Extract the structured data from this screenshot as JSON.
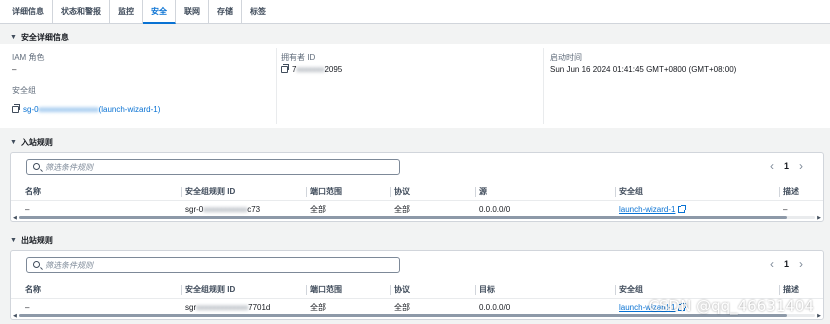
{
  "tabs": [
    {
      "label": "详细信息",
      "active": false
    },
    {
      "label": "状态和警报",
      "active": false
    },
    {
      "label": "监控",
      "active": false
    },
    {
      "label": "安全",
      "active": true
    },
    {
      "label": "联网",
      "active": false
    },
    {
      "label": "存储",
      "active": false
    },
    {
      "label": "标签",
      "active": false
    }
  ],
  "security_details": {
    "title": "安全详细信息",
    "iam_role_label": "IAM 角色",
    "iam_role_value": "–",
    "owner_id_label": "拥有者 ID",
    "owner_id_prefix": "7",
    "owner_id_suffix": "2095",
    "launch_time_label": "启动时间",
    "launch_time_value": "Sun Jun 16 2024 01:41:45 GMT+0800 (GMT+08:00)",
    "security_group_label": "安全组",
    "security_group_prefix": "sg-0",
    "security_group_suffix": "(launch-wizard-1)"
  },
  "inbound": {
    "title": "入站规则",
    "search_placeholder": "筛选条件规则",
    "page": "1",
    "columns": [
      "名称",
      "安全组规则 ID",
      "端口范围",
      "协议",
      "源",
      "安全组",
      "描述"
    ],
    "row": {
      "name": "–",
      "rule_id_prefix": "sgr-0",
      "rule_id_suffix": "c73",
      "port_range": "全部",
      "protocol": "全部",
      "source": "0.0.0.0/0",
      "security_group": "launch-wizard-1",
      "description": "–"
    }
  },
  "outbound": {
    "title": "出站规则",
    "search_placeholder": "筛选条件规则",
    "page": "1",
    "columns": [
      "名称",
      "安全组规则 ID",
      "端口范围",
      "协议",
      "目标",
      "安全组",
      "描述"
    ],
    "row": {
      "name": "–",
      "rule_id_prefix": "sgr",
      "rule_id_suffix": "7701d",
      "port_range": "全部",
      "protocol": "全部",
      "destination": "0.0.0.0/0",
      "security_group": "launch-wizard-1"
    }
  },
  "watermark": "CSDN @qq_46631404",
  "colors": {
    "link": "#0972d3",
    "text": "#16191f",
    "label": "#5f6b7a",
    "page_bg": "#f2f3f3",
    "panel_bg": "#ffffff"
  },
  "icons": [
    "caret-down-icon",
    "copy-icon",
    "search-icon",
    "chevron-left-icon",
    "chevron-right-icon",
    "external-link-icon"
  ]
}
